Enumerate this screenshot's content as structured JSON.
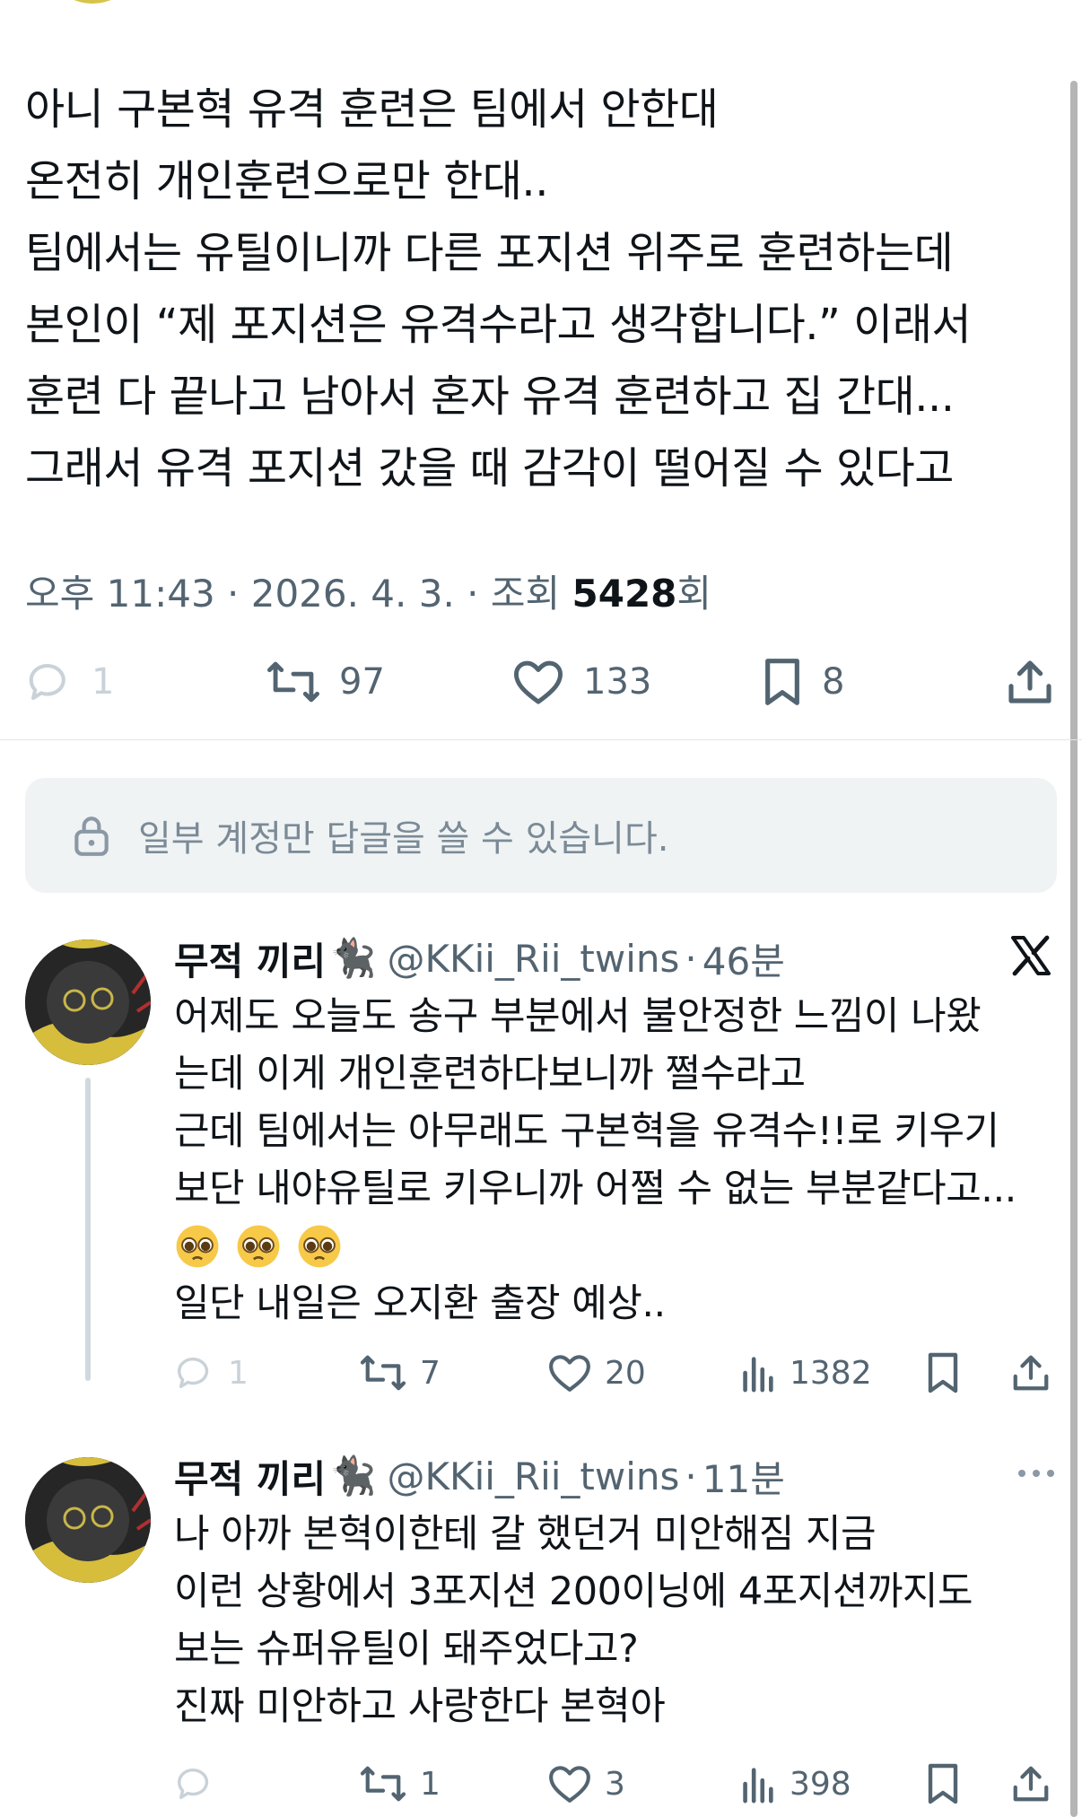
{
  "tweet": {
    "lines": [
      "아니 구본혁 유격 훈련은 팀에서 안한대",
      "온전히 개인훈련으로만 한대..",
      "팀에서는 유틸이니까 다른 포지션 위주로 훈련하는데",
      "본인이 “제 포지션은 유격수라고 생각합니다.” 이래서",
      "훈련 다 끝나고 남아서 혼자 유격 훈련하고 집 간대...",
      "그래서 유격 포지션 갔을 때 감각이 떨어질 수 있다고"
    ],
    "meta_time": "오후 11:43 · 2026. 4. 3. · 조회 ",
    "meta_views": "5428",
    "meta_views_suffix": "회",
    "actions": {
      "replies": "1",
      "reposts": "97",
      "likes": "133",
      "bookmarks": "8"
    }
  },
  "reply_notice": "일부 계정만 답글을 쓸 수 있습니다.",
  "replies": [
    {
      "name": "무적 끼리",
      "emoji_after_name": "🐈‍⬛",
      "handle": "@KKii_Rii_twins",
      "separator": "·",
      "time": "46분",
      "lines": [
        "어제도 오늘도 송구 부분에서 불안정한 느낌이 나왔",
        "는데 이게 개인훈련하다보니까 쩔수라고",
        "근데 팀에서는 아무래도 구본혁을 유격수!!로 키우기",
        "보단 내야유틸로 키우니까 어쩔 수 없는 부분같다고...",
        "",
        "일단 내일은 오지환 출장 예상.."
      ],
      "actions": {
        "replies": "1",
        "reposts": "7",
        "likes": "20",
        "views": "1382"
      }
    },
    {
      "name": "무적 끼리",
      "emoji_after_name": "🐈‍⬛",
      "handle": "@KKii_Rii_twins",
      "separator": "·",
      "time": "11분",
      "lines": [
        "나 아까 본혁이한테 갈 했던거 미안해짐 지금",
        "이런 상황에서 3포지션 200이닝에 4포지션까지도",
        "보는 슈퍼유틸이 돼주었다고?",
        "진짜 미안하고 사랑한다 본혁아"
      ],
      "actions": {
        "replies": "",
        "reposts": "1",
        "likes": "3",
        "views": "398"
      }
    }
  ],
  "colors": {
    "text": "#0f1419",
    "muted": "#536471",
    "faint": "#cfd9de",
    "notice_bg": "#eff3f4"
  }
}
